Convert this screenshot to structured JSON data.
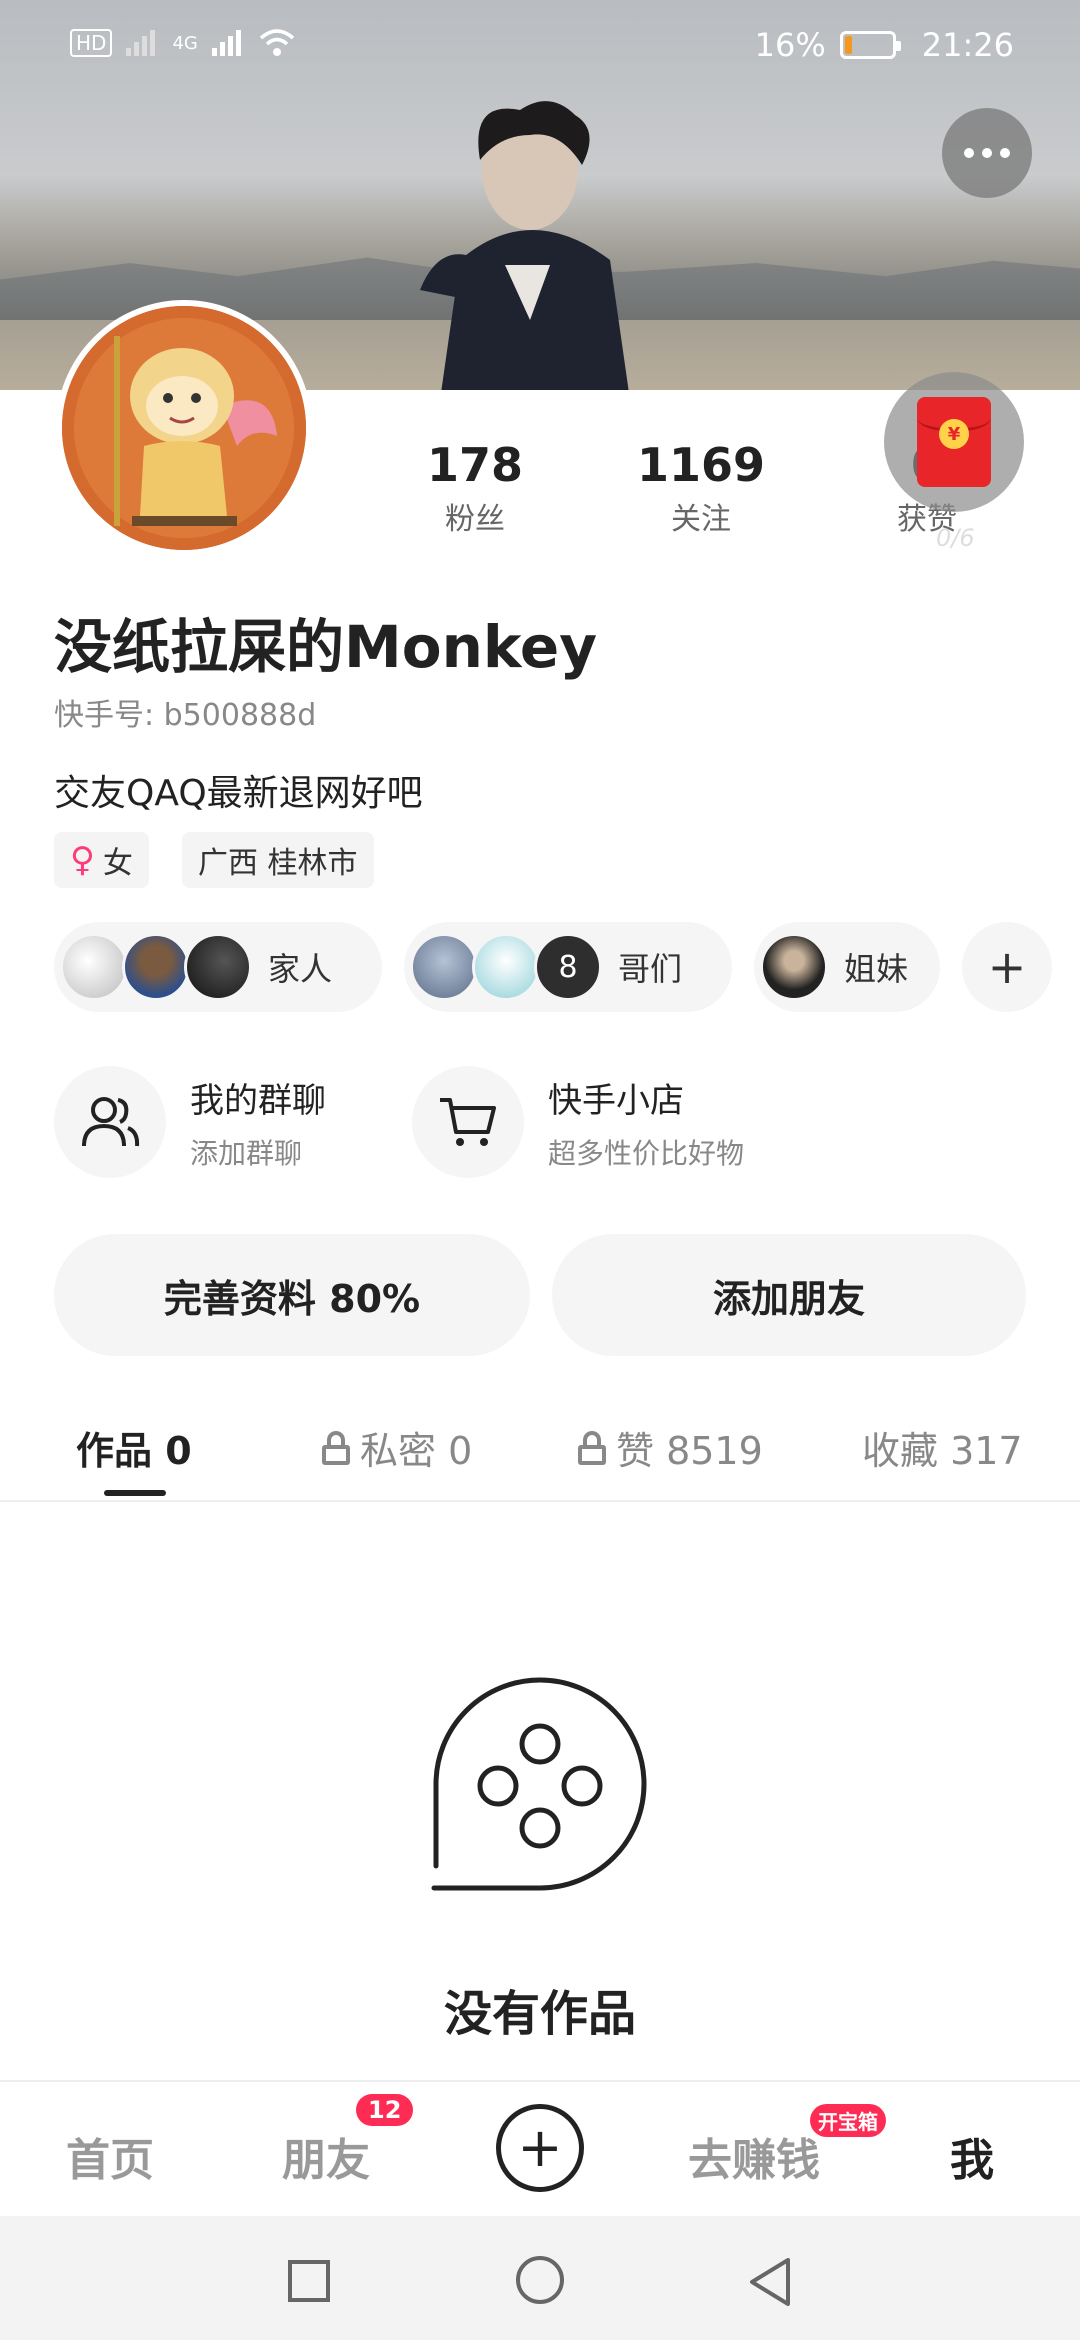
{
  "status_bar": {
    "hd_label": "HD",
    "network": "4G",
    "battery_text": "16%",
    "battery_level": 0.16,
    "time": "21:26"
  },
  "profile": {
    "stats": [
      {
        "value": "178",
        "label": "粉丝"
      },
      {
        "value": "1169",
        "label": "关注"
      },
      {
        "value": "0",
        "label": "获赞"
      }
    ],
    "red_packet_progress": "0/6",
    "name": "没纸拉屎的Monkey",
    "kuaishou_id": "快手号: b500888d",
    "bio": "交友QAQ最新退网好吧",
    "tags": {
      "gender": "女",
      "location": "广西 桂林市"
    },
    "groups": [
      {
        "label": "家人"
      },
      {
        "label": "哥们",
        "count": "8"
      },
      {
        "label": "姐妹"
      }
    ],
    "add_group_symbol": "+",
    "shortcuts": [
      {
        "title": "我的群聊",
        "subtitle": "添加群聊",
        "icon": "group-chat-icon"
      },
      {
        "title": "快手小店",
        "subtitle": "超多性价比好物",
        "icon": "shopping-cart-icon"
      }
    ],
    "buttons": {
      "complete_profile": "完善资料 80%",
      "add_friend": "添加朋友"
    }
  },
  "tabs": [
    {
      "label": "作品 0",
      "locked": false,
      "active": true
    },
    {
      "label": "私密 0",
      "locked": true,
      "active": false
    },
    {
      "label": "赞 8519",
      "locked": true,
      "active": false
    },
    {
      "label": "收藏 317",
      "locked": false,
      "active": false
    }
  ],
  "empty_state": {
    "text": "没有作品"
  },
  "bottom_nav": {
    "home": "首页",
    "friends": "朋友",
    "friends_badge": "12",
    "create_symbol": "+",
    "earn": "去赚钱",
    "earn_badge": "开宝箱",
    "me": "我"
  },
  "colors": {
    "accent_pink": "#fe2c55",
    "red_packet": "#e8262a",
    "battery_low": "#f39a1e"
  }
}
